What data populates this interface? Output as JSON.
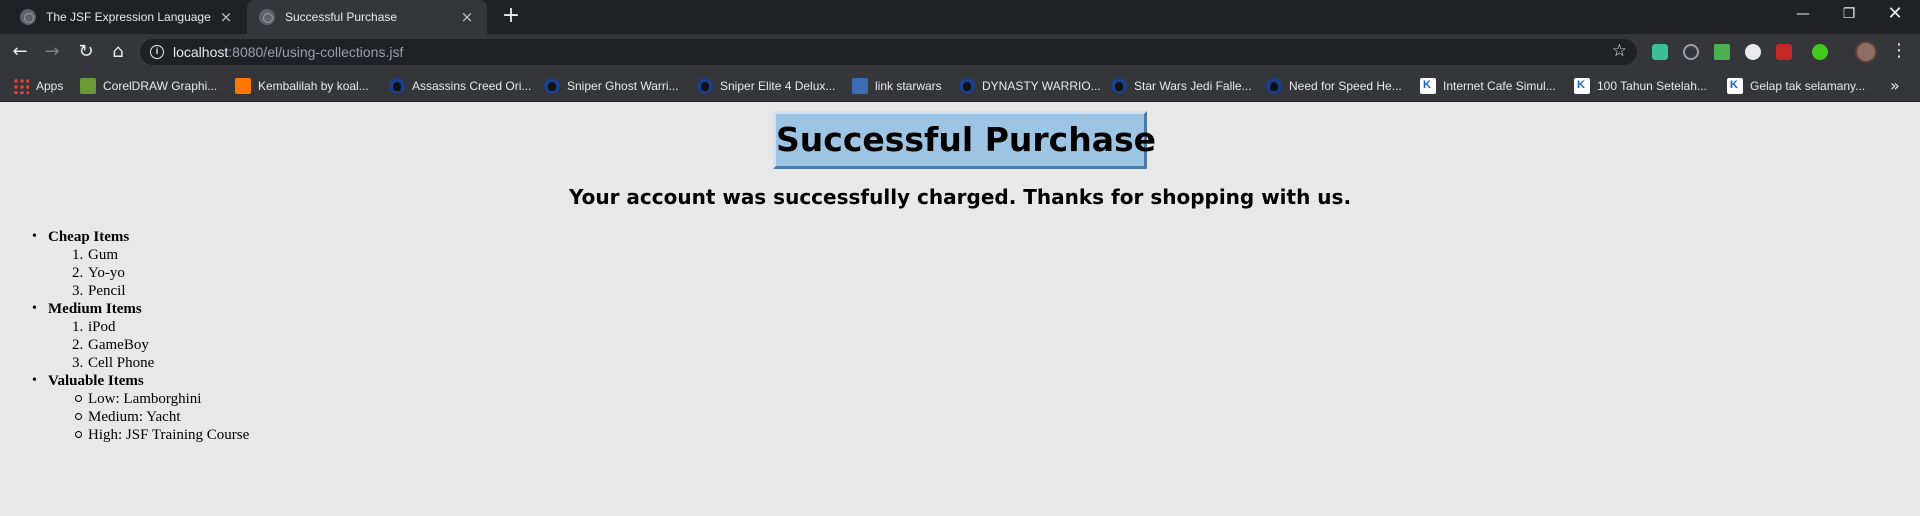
{
  "tabs": [
    {
      "title": "The JSF Expression Language",
      "close": "×"
    },
    {
      "title": "Successful Purchase",
      "close": "×"
    }
  ],
  "new_tab": "+",
  "window_controls": {
    "minimize": "—",
    "maximize": "❐",
    "close": "✕"
  },
  "toolbar": {
    "back": "←",
    "forward": "→",
    "reload": "↻",
    "home": "⌂",
    "url_host": "localhost",
    "url_rest": ":8080/el/using-collections.jsf",
    "info": "i",
    "star": "☆",
    "menu": "⋮"
  },
  "bookmarks": [
    {
      "label": "Apps",
      "icon": "apps-icon"
    },
    {
      "label": "CorelDRAW Graphi...",
      "icon": "corel-icon"
    },
    {
      "label": "Kembalilah by koal...",
      "icon": "soundcloud-icon"
    },
    {
      "label": "Assassins Creed Ori...",
      "icon": "game-icon"
    },
    {
      "label": "Sniper Ghost Warri...",
      "icon": "game-icon"
    },
    {
      "label": "Sniper Elite 4 Delux...",
      "icon": "game-icon"
    },
    {
      "label": "link starwars",
      "icon": "link-icon"
    },
    {
      "label": "DYNASTY WARRIO...",
      "icon": "game-icon"
    },
    {
      "label": "Star Wars Jedi Falle...",
      "icon": "game-icon"
    },
    {
      "label": "Need for Speed He...",
      "icon": "game-icon"
    },
    {
      "label": "Internet Cafe Simul...",
      "icon": "k-icon"
    },
    {
      "label": "100 Tahun Setelah...",
      "icon": "k-icon"
    },
    {
      "label": "Gelap tak selamany...",
      "icon": "k-icon"
    }
  ],
  "bookmarks_more": "»",
  "page": {
    "heading": "Successful Purchase",
    "subtitle": "Your account was successfully charged. Thanks for shopping with us.",
    "bullet": "•",
    "categories": [
      {
        "label": "Cheap Items",
        "items": [
          "Gum",
          "Yo-yo",
          "Pencil"
        ],
        "markers": [
          "1.",
          "2.",
          "3."
        ]
      },
      {
        "label": "Medium Items",
        "items": [
          "iPod",
          "GameBoy",
          "Cell Phone"
        ],
        "markers": [
          "1.",
          "2.",
          "3."
        ]
      },
      {
        "label": "Valuable Items",
        "items": [
          "Low: Lamborghini",
          "Medium: Yacht",
          "High: JSF Training Course"
        ]
      }
    ]
  },
  "colors": {
    "tabstrip": "#202124",
    "toolbar": "#35363a",
    "page_background": "#e8e8e8",
    "heading_box": "#9ec4e4"
  }
}
